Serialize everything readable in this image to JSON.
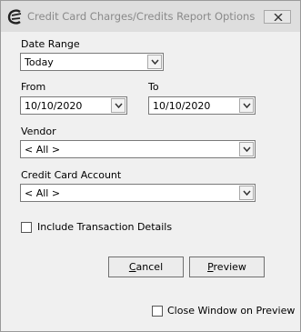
{
  "window": {
    "title": "Credit Card Charges/Credits Report Options",
    "app_icon": "app-logo-icon",
    "close_icon": "close-icon"
  },
  "date_range": {
    "label": "Date Range",
    "value": "Today"
  },
  "from": {
    "label": "From",
    "value": "10/10/2020"
  },
  "to": {
    "label": "To",
    "value": "10/10/2020"
  },
  "vendor": {
    "label": "Vendor",
    "value": "< All >"
  },
  "credit_card_account": {
    "label": "Credit Card Account",
    "value": "< All >"
  },
  "include_details": {
    "label": "Include Transaction Details",
    "checked": false
  },
  "buttons": {
    "cancel": {
      "first": "C",
      "rest": "ancel"
    },
    "preview": {
      "first": "P",
      "rest": "review"
    }
  },
  "close_on_preview": {
    "label": "Close Window on Preview",
    "checked": false
  },
  "dropdown_icon": "chevron-down-icon"
}
